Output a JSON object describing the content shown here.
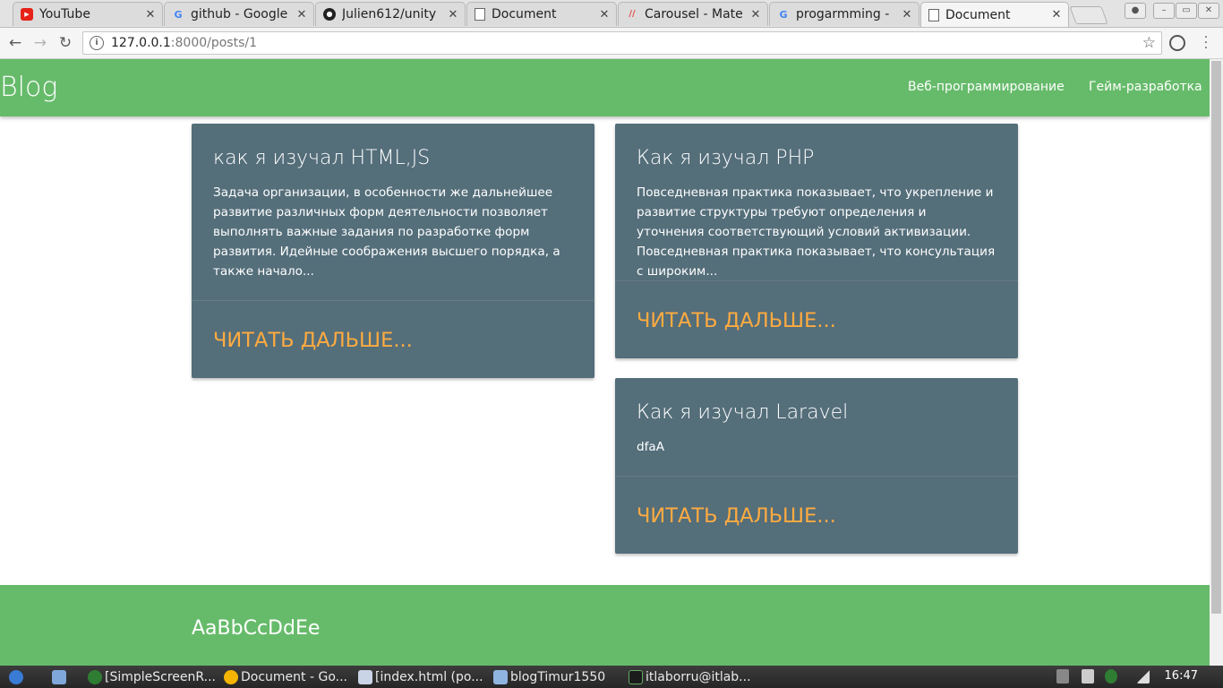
{
  "browser": {
    "tabs": [
      {
        "title": "YouTube",
        "favicon": "youtube-icon"
      },
      {
        "title": "github - Google",
        "favicon": "google-icon"
      },
      {
        "title": "Julien612/unity",
        "favicon": "github-icon"
      },
      {
        "title": "Document",
        "favicon": "document-icon"
      },
      {
        "title": "Carousel - Mate",
        "favicon": "materialize-icon"
      },
      {
        "title": "progarmming -",
        "favicon": "google-icon"
      },
      {
        "title": "Document",
        "favicon": "document-icon",
        "active": true
      }
    ],
    "url_host": "127.0.0.1",
    "url_path": ":8000/posts/1"
  },
  "page": {
    "brand": "Blog",
    "nav": [
      "Веб-программирование",
      "Гейм-разработка"
    ],
    "posts": [
      {
        "title": "как я изучал HTML,JS",
        "excerpt": "Задача организации, в особенности же дальнейшее развитие различных форм деятельности позволяет выполнять важные задания по разработке форм развития. Идейные соображения высшего порядка, а также начало...",
        "link": "Читать дальше..."
      },
      {
        "title": "Как я изучал PHP",
        "excerpt": "Повседневная практика показывает, что укрепление и развитие структуры требуют определения и уточнения соответствующий условий активизации. Повседневная практика показывает, что консультация с широким...",
        "link": "Читать дальше..."
      },
      {
        "title": "Как я изучал Laravel",
        "excerpt": "dfaA",
        "link": "Читать дальше..."
      }
    ],
    "footer_title": "AaBbCcDdEe",
    "colors": {
      "primary": "#66bb6a",
      "card": "#546e7a",
      "link": "#ffab40"
    }
  },
  "taskbar": {
    "items": [
      "[SimpleScreenR...",
      "Document - Go...",
      "[index.html (po...",
      "blogTimur1550",
      "itlaborru@itlab..."
    ],
    "clock": "16:47"
  }
}
